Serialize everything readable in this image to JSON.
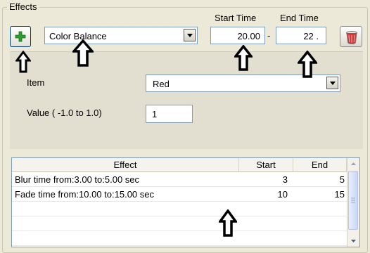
{
  "group": {
    "label": "Effects"
  },
  "header": {
    "start_label": "Start Time",
    "end_label": "End Time"
  },
  "controls": {
    "effect_select": "Color Balance",
    "start_value": "20.00",
    "separator": "-",
    "end_value": "22 ."
  },
  "settings": {
    "item_label": "Item",
    "item_value": "Red",
    "value_label": "Value ( -1.0 to 1.0)",
    "value_value": "1"
  },
  "table": {
    "columns": [
      "Effect",
      "Start",
      "End"
    ],
    "rows": [
      {
        "effect": "Blur time from:3.00 to:5.00 sec",
        "start": "3",
        "end": "5"
      },
      {
        "effect": "Fade time from:10.00 to:15.00 sec",
        "start": "10",
        "end": "15"
      }
    ]
  },
  "icons": {
    "add": "plus-icon",
    "trash": "trash-icon",
    "dropdown": "chevron-down-icon",
    "annotation": "up-arrow-icon"
  },
  "colors": {
    "plus_green": "#2e9e2e",
    "selection_border": "#7f9db9"
  }
}
